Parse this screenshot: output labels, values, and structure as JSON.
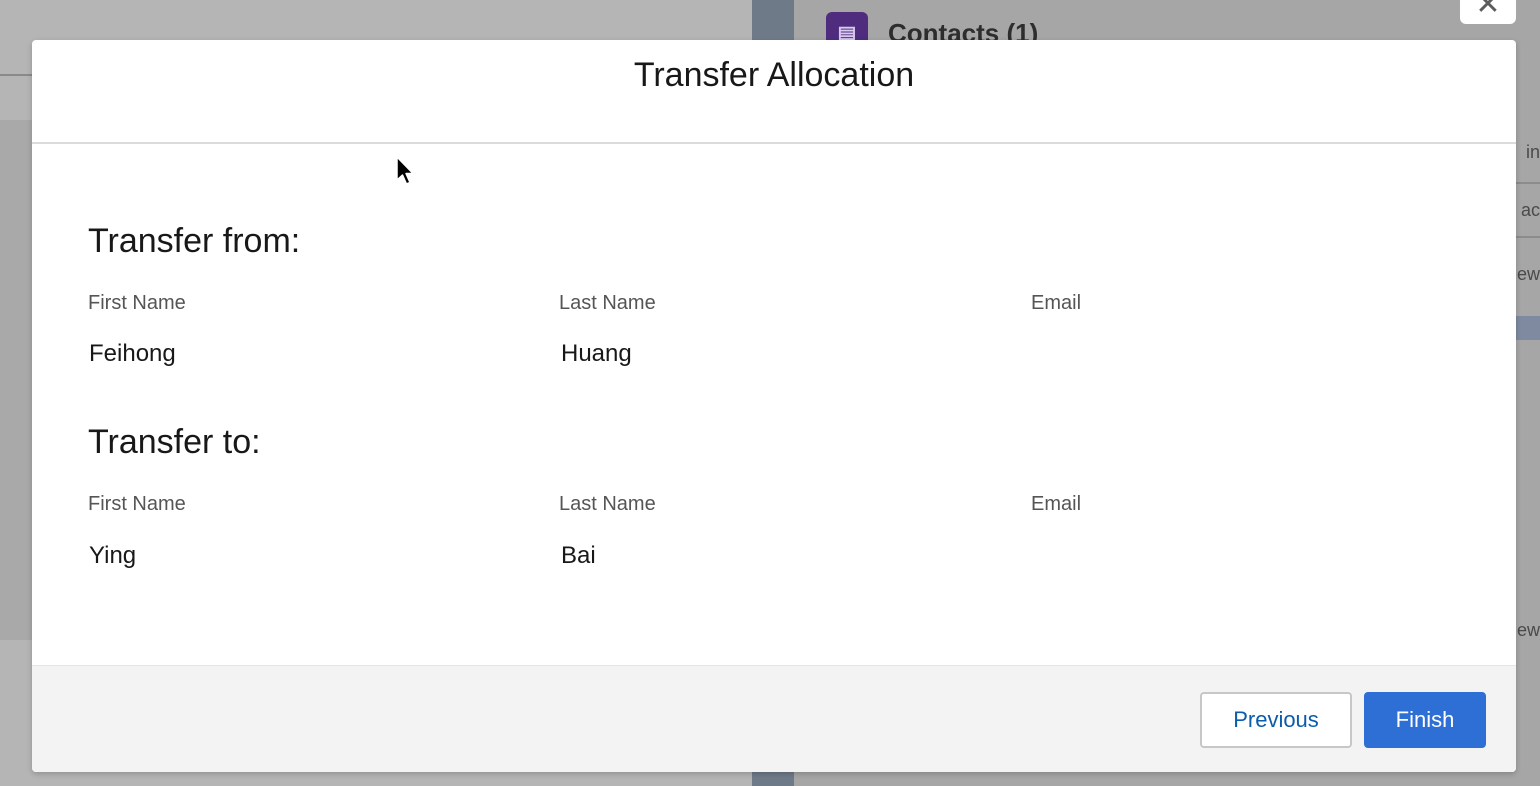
{
  "background": {
    "contacts_title": "Contacts (1)",
    "contacts_icon": "contact-card-icon",
    "close_icon": "close-icon",
    "right_fragments": [
      "in",
      "ac",
      "ew",
      "ew"
    ]
  },
  "modal": {
    "title": "Transfer Allocation",
    "from": {
      "heading": "Transfer from:",
      "labels": {
        "first": "First Name",
        "last": "Last Name",
        "email": "Email"
      },
      "values": {
        "first": "Feihong",
        "last": "Huang",
        "email": ""
      }
    },
    "to": {
      "heading": "Transfer to:",
      "labels": {
        "first": "First Name",
        "last": "Last Name",
        "email": "Email"
      },
      "values": {
        "first": "Ying",
        "last": "Bai",
        "email": ""
      }
    },
    "footer": {
      "previous_label": "Previous",
      "finish_label": "Finish"
    }
  },
  "colors": {
    "brand_blue": "#2e6fd6",
    "link_blue": "#0b5cab",
    "overlay_gray": "#a3a3a3",
    "contacts_purple": "#4f2c7d"
  }
}
